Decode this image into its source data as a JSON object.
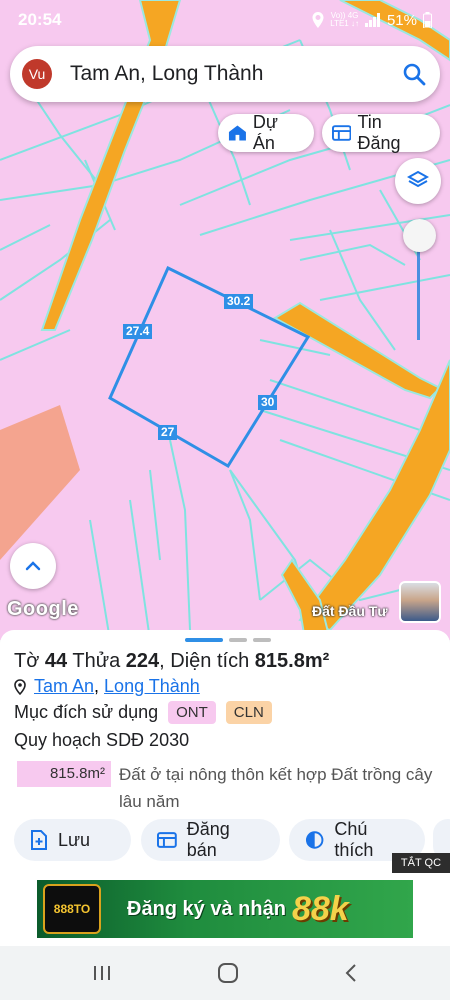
{
  "status_bar": {
    "time": "20:54",
    "network_top": "Vo)) 4G",
    "network_bottom": "LTE1 ↓↑",
    "battery": "51%"
  },
  "search": {
    "avatar_initials": "Vu",
    "query": "Tam An, Long Thành"
  },
  "chips": {
    "du_an": "Dự Án",
    "tin_dang": "Tin Đăng"
  },
  "map": {
    "edge_labels": [
      "30.2",
      "27.4",
      "30",
      "27"
    ],
    "attribution": "Google",
    "brand": "Đất Đầu Tư"
  },
  "parcel": {
    "sheet_prefix": "Tờ",
    "sheet_no": "44",
    "plot_prefix": "Thửa",
    "plot_no": "224",
    "area_prefix": ", Diện tích",
    "area": "815.8m²",
    "location_commune": "Tam An",
    "location_separator": ", ",
    "location_district": "Long Thành",
    "purpose_label": "Mục đích sử dụng",
    "purpose_tags": [
      "ONT",
      "CLN"
    ],
    "plan_label": "Quy hoạch SDĐ 2030",
    "plan_area": "815.8m²",
    "plan_description": "Đất ở tại nông thôn kết hợp Đất trồng cây lâu năm"
  },
  "actions": {
    "save": "Lưu",
    "post_sale": "Đăng bán",
    "legend": "Chú thích"
  },
  "ad": {
    "badge": "TẮT QC",
    "logo_text": "888TO",
    "text": "Đăng ký và nhận",
    "amount": "88k"
  },
  "colors": {
    "map_background": "#f7c9ef",
    "road": "#f5a623",
    "parcel_line": "#2f8fe6",
    "accent": "#1a73e8"
  }
}
